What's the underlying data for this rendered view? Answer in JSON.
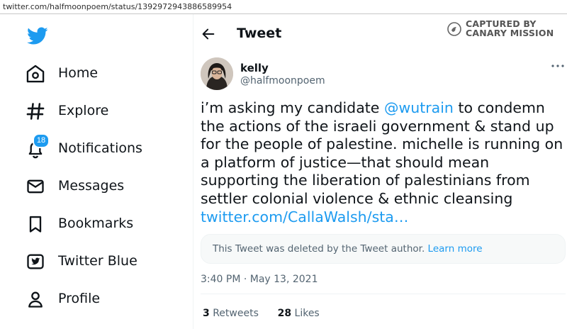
{
  "browser": {
    "url": "twitter.com/halfmoonpoem/status/1392972943886589954"
  },
  "colors": {
    "accent": "#1d9bf0",
    "text": "#0f1419",
    "muted": "#536471"
  },
  "sidebar": {
    "logo_icon": "twitter-bird-icon",
    "items": [
      {
        "label": "Home",
        "icon": "home-icon"
      },
      {
        "label": "Explore",
        "icon": "hashtag-icon"
      },
      {
        "label": "Notifications",
        "icon": "bell-icon",
        "badge": "18"
      },
      {
        "label": "Messages",
        "icon": "envelope-icon"
      },
      {
        "label": "Bookmarks",
        "icon": "bookmark-icon"
      },
      {
        "label": "Twitter Blue",
        "icon": "twitter-blue-icon"
      },
      {
        "label": "Profile",
        "icon": "person-icon"
      }
    ]
  },
  "header": {
    "title": "Tweet",
    "back_icon": "back-arrow-icon"
  },
  "watermark": {
    "line1": "CAPTURED BY",
    "line2": "CANARY MISSION"
  },
  "tweet": {
    "author_name": "kelly",
    "author_handle": "@halfmoonpoem",
    "text_before": "i’m asking my candidate ",
    "mention": "@wutrain",
    "text_after": " to condemn the actions of the israeli government & stand up for the people of palestine. michelle is running on a platform of justice—that should mean supporting the liberation of palestinians from settler colonial violence & ethnic cleansing ",
    "link": "twitter.com/CallaWalsh/sta…",
    "quote_notice": "This Tweet was deleted by the Tweet author.",
    "quote_link": "Learn more",
    "timestamp": "3:40 PM · May 13, 2021",
    "retweets_count": "3",
    "retweets_label": "Retweets",
    "likes_count": "28",
    "likes_label": "Likes"
  }
}
